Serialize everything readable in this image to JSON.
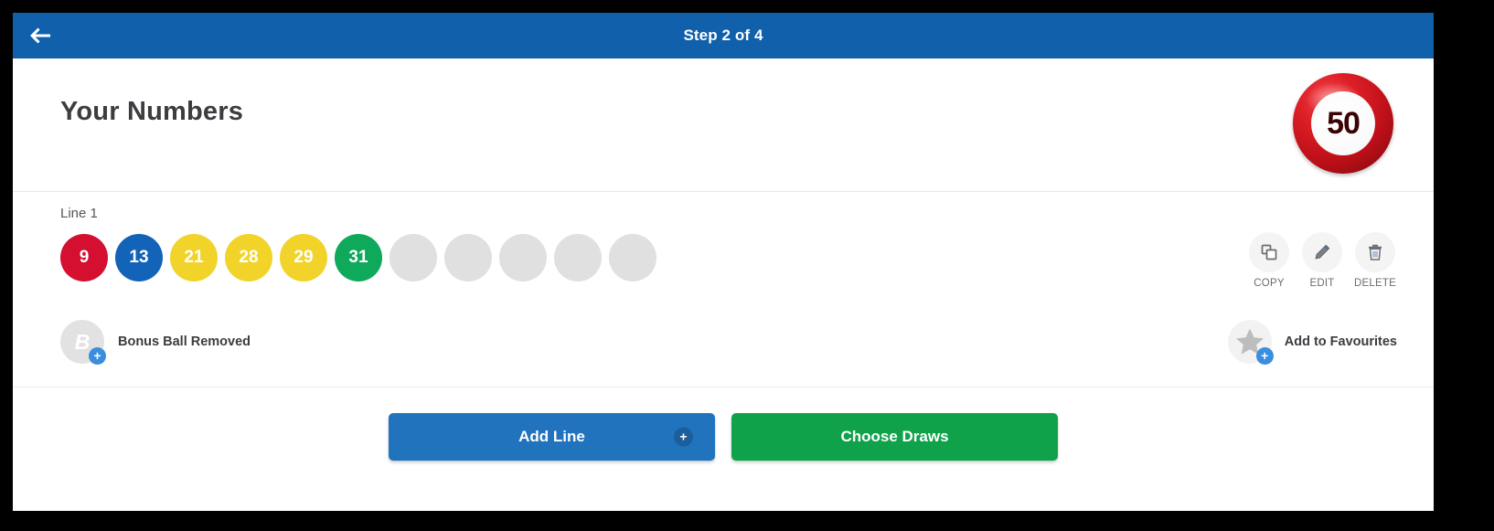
{
  "header": {
    "back_icon": "arrow-left-icon",
    "title": "Step 2 of 4"
  },
  "page": {
    "title": "Your Numbers",
    "jackpot_badge": {
      "value": "50",
      "color": "#c8101c"
    }
  },
  "line": {
    "label": "Line 1",
    "balls": [
      {
        "number": "9",
        "color": "#d40f2f"
      },
      {
        "number": "13",
        "color": "#1363b8"
      },
      {
        "number": "21",
        "color": "#f2d32a"
      },
      {
        "number": "28",
        "color": "#f2d32a"
      },
      {
        "number": "29",
        "color": "#f2d32a"
      },
      {
        "number": "31",
        "color": "#0fa95c"
      }
    ],
    "empty_slots": 5,
    "empty_color": "#e0e0e0"
  },
  "actions": [
    {
      "icon": "copy-icon",
      "label": "COPY"
    },
    {
      "icon": "pencil-icon",
      "label": "EDIT"
    },
    {
      "icon": "trash-icon",
      "label": "DELETE"
    }
  ],
  "bonus": {
    "avatar_letter": "B",
    "label": "Bonus Ball Removed",
    "badge": "+"
  },
  "favourites": {
    "icon": "star-icon",
    "label": "Add to Favourites",
    "badge": "+"
  },
  "footer": {
    "add_line_label": "Add Line",
    "add_line_badge": "+",
    "add_line_color": "#2273bd",
    "choose_draws_label": "Choose Draws",
    "choose_draws_color": "#0fa24a"
  }
}
